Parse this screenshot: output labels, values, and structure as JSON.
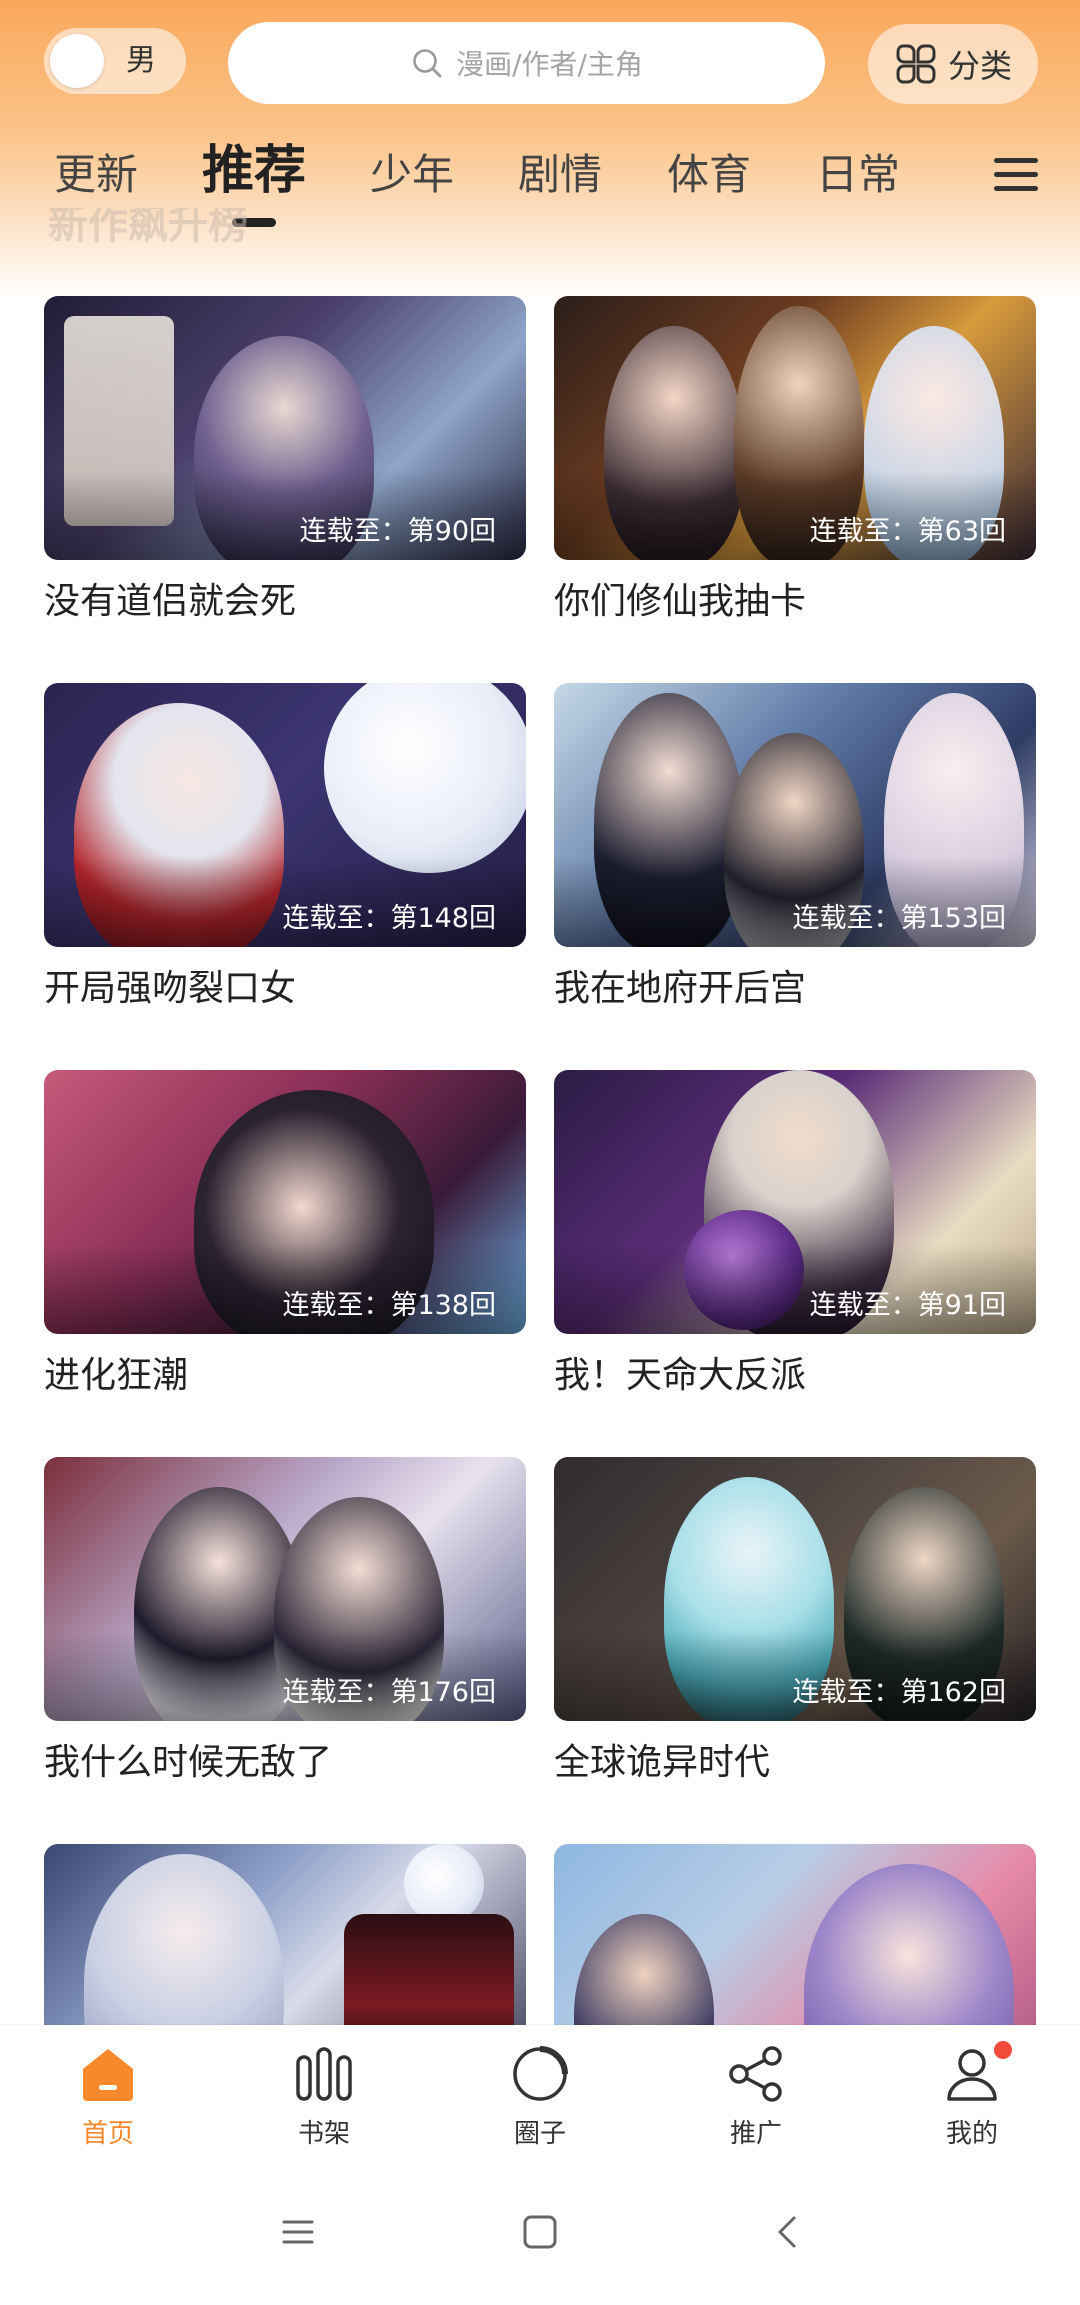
{
  "header": {
    "gender_label": "男",
    "search_placeholder": "漫画/作者/主角",
    "category_label": "分类"
  },
  "tabs": [
    {
      "label": "更新",
      "active": false
    },
    {
      "label": "推荐",
      "active": true
    },
    {
      "label": "少年",
      "active": false
    },
    {
      "label": "剧情",
      "active": false
    },
    {
      "label": "体育",
      "active": false
    },
    {
      "label": "日常",
      "active": false
    }
  ],
  "section_peek": "新作飙升榜",
  "comics": [
    {
      "title": "没有道侣就会死",
      "badge": "连载至：第90回"
    },
    {
      "title": "你们修仙我抽卡",
      "badge": "连载至：第63回"
    },
    {
      "title": "开局强吻裂口女",
      "badge": "连载至：第148回"
    },
    {
      "title": "我在地府开后宫",
      "badge": "连载至：第153回"
    },
    {
      "title": "进化狂潮",
      "badge": "连载至：第138回"
    },
    {
      "title": "我！天命大反派",
      "badge": "连载至：第91回"
    },
    {
      "title": "我什么时候无敌了",
      "badge": "连载至：第176回"
    },
    {
      "title": "全球诡异时代",
      "badge": "连载至：第162回"
    },
    {
      "title": "",
      "badge": ""
    },
    {
      "title": "",
      "badge": ""
    }
  ],
  "bottom_nav": [
    {
      "label": "首页",
      "active": true,
      "icon": "home-icon"
    },
    {
      "label": "书架",
      "active": false,
      "icon": "bookshelf-icon"
    },
    {
      "label": "圈子",
      "active": false,
      "icon": "circle-icon"
    },
    {
      "label": "推广",
      "active": false,
      "icon": "share-icon"
    },
    {
      "label": "我的",
      "active": false,
      "icon": "profile-icon"
    }
  ],
  "colors": {
    "accent": "#f7892c",
    "notification": "#f24b3b",
    "header_gradient_top": "#f9a85b"
  }
}
